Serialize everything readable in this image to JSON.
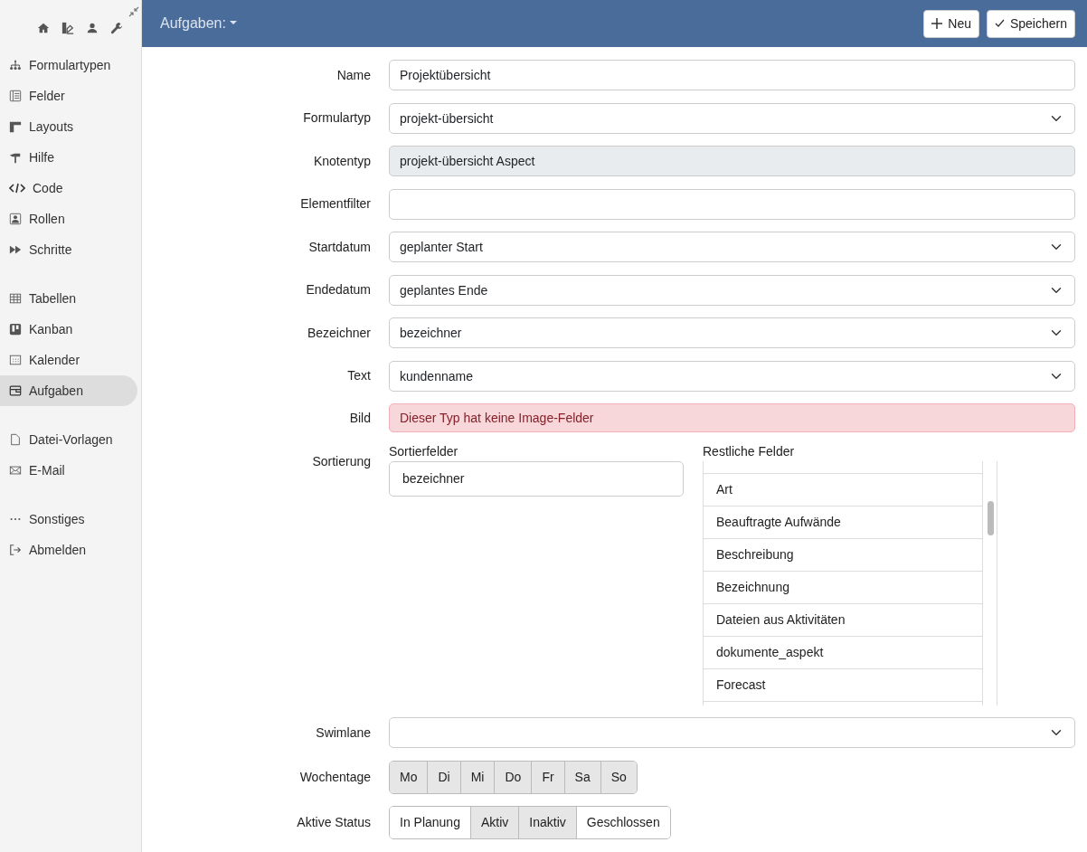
{
  "sidebar": {
    "groups": [
      [
        {
          "label": "Formulartypen",
          "selected": false
        },
        {
          "label": "Felder",
          "selected": false
        },
        {
          "label": "Layouts",
          "selected": false
        },
        {
          "label": "Hilfe",
          "selected": false
        },
        {
          "label": "Code",
          "selected": false
        },
        {
          "label": "Rollen",
          "selected": false
        },
        {
          "label": "Schritte",
          "selected": false
        }
      ],
      [
        {
          "label": "Tabellen",
          "selected": false
        },
        {
          "label": "Kanban",
          "selected": false
        },
        {
          "label": "Kalender",
          "selected": false
        },
        {
          "label": "Aufgaben",
          "selected": true
        }
      ],
      [
        {
          "label": "Datei-Vorlagen",
          "selected": false
        },
        {
          "label": "E-Mail",
          "selected": false
        }
      ],
      [
        {
          "label": "Sonstiges",
          "selected": false
        },
        {
          "label": "Abmelden",
          "selected": false
        }
      ]
    ]
  },
  "header": {
    "title": "Aufgaben:",
    "buttons": [
      {
        "label": "Neu"
      },
      {
        "label": "Speichern"
      }
    ]
  },
  "form": [
    {
      "label": "Name",
      "kind": "input",
      "value": "Projektübersicht"
    },
    {
      "label": "Formulartyp",
      "kind": "select",
      "value": "projekt-übersicht"
    },
    {
      "label": "Knotentyp",
      "kind": "readonly",
      "value": "projekt-übersicht Aspect"
    },
    {
      "label": "Elementfilter",
      "kind": "input"
    },
    {
      "label": "Startdatum",
      "kind": "select",
      "value": "geplanter Start"
    },
    {
      "label": "Endedatum",
      "kind": "select",
      "value": "geplantes Ende"
    },
    {
      "label": "Bezeichner",
      "kind": "select",
      "value": "bezeichner"
    },
    {
      "label": "Text",
      "kind": "select",
      "value": "kundenname"
    },
    {
      "label": "Bild",
      "kind": "alert",
      "value": "Dieser Typ hat keine Image-Felder"
    },
    {
      "label": "Sortierung",
      "kind": "sort",
      "sorted_title": "Sortierfelder",
      "sorted": [
        "bezeichner"
      ],
      "rest_title": "Restliche Felder",
      "rest": [
        "Art",
        "Beauftragte Aufwände",
        "Beschreibung",
        "Bezeichnung",
        "Dateien aus Aktivitäten",
        "dokumente_aspekt",
        "Forecast"
      ]
    },
    {
      "label": "Swimlane",
      "kind": "select"
    },
    {
      "label": "Wochentage",
      "kind": "toggles",
      "options": [
        {
          "label": "Mo",
          "selected": true
        },
        {
          "label": "Di",
          "selected": true
        },
        {
          "label": "Mi",
          "selected": true
        },
        {
          "label": "Do",
          "selected": true
        },
        {
          "label": "Fr",
          "selected": true
        },
        {
          "label": "Sa",
          "selected": true
        },
        {
          "label": "So",
          "selected": true
        }
      ]
    },
    {
      "label": "Aktive Status",
      "kind": "toggles",
      "options": [
        {
          "label": "In Planung",
          "selected": false
        },
        {
          "label": "Aktiv",
          "selected": true
        },
        {
          "label": "Inaktiv",
          "selected": true
        },
        {
          "label": "Geschlossen",
          "selected": false
        }
      ]
    }
  ]
}
